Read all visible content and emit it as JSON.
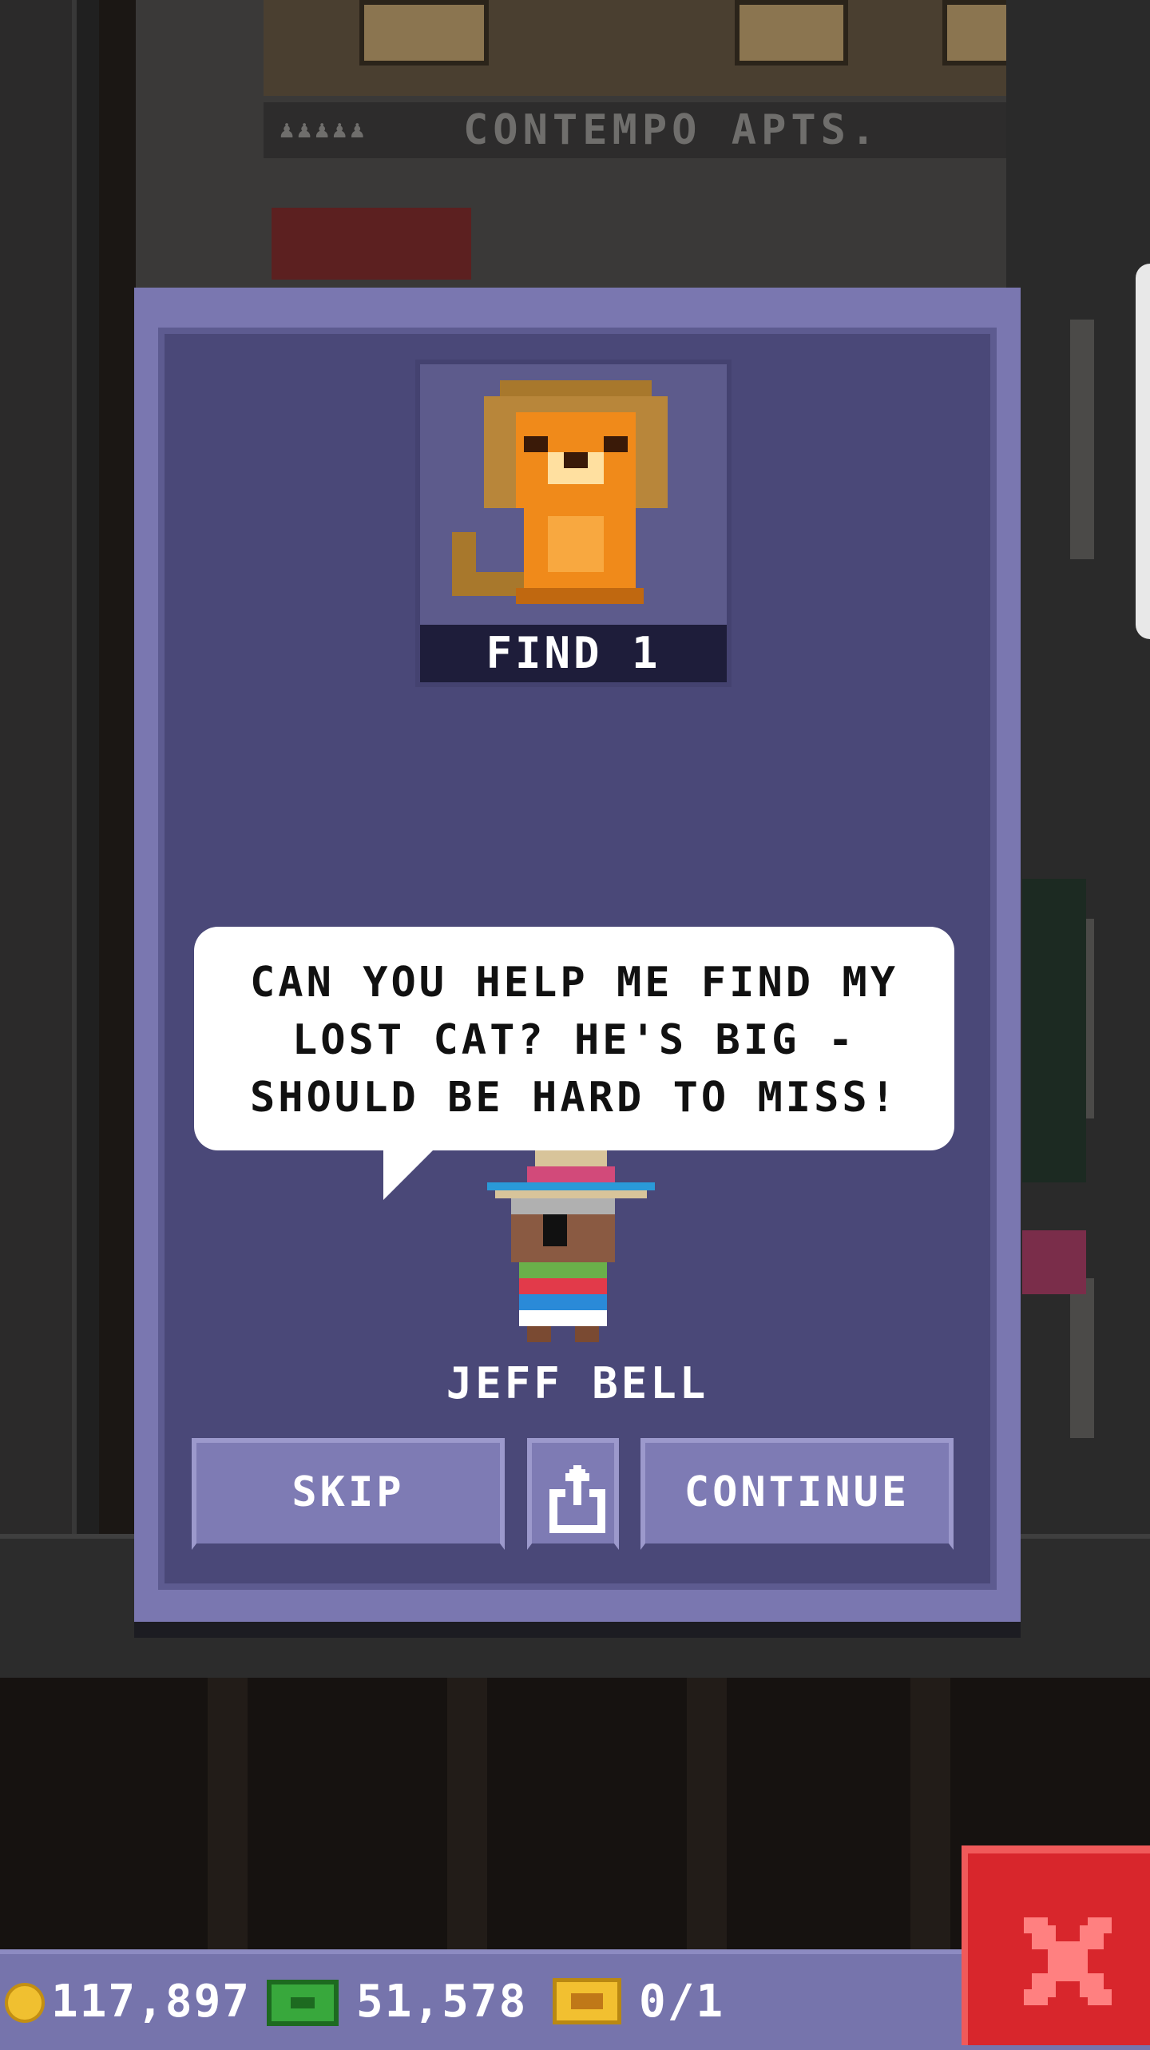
{
  "background": {
    "building_sign": "CONTEMPO APTS."
  },
  "quest": {
    "objective_label": "FIND 1",
    "objective_icon": "lion-icon",
    "dialogue": [
      "CAN YOU HELP ME FIND MY",
      "LOST CAT? HE'S BIG -",
      "SHOULD BE HARD TO MISS!"
    ],
    "npc_name": "JEFF BELL"
  },
  "actions": {
    "skip_label": "SKIP",
    "share_icon": "share-icon",
    "continue_label": "CONTINUE"
  },
  "status": {
    "coins": "117,897",
    "bux": "51,578",
    "vip": "0/1"
  },
  "colors": {
    "dialog_frame": "#7a77b0",
    "dialog_inner": "#4a4878",
    "button": "#7e7bb4",
    "close": "#d8262c",
    "coin": "#f0c030",
    "cash": "#38a83c"
  }
}
